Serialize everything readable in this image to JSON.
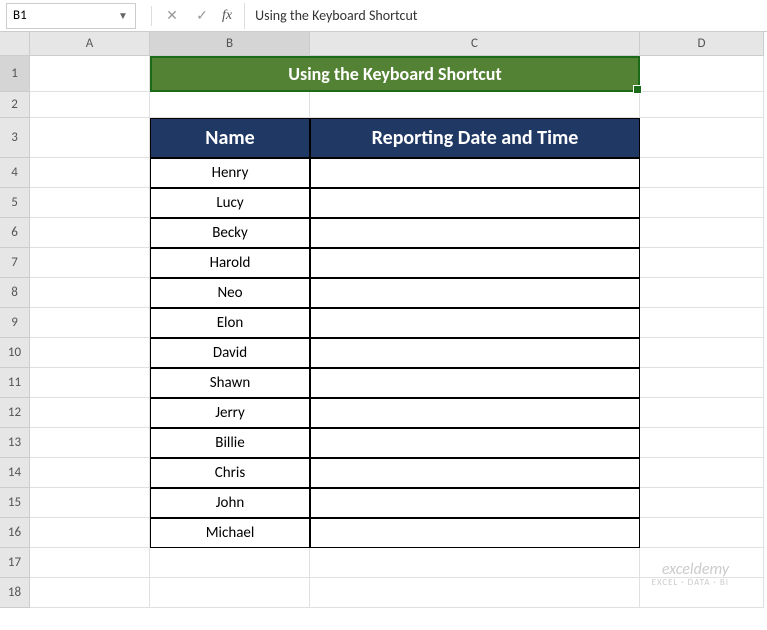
{
  "namebox": "B1",
  "formula_value": "Using the Keyboard Shortcut",
  "columns": [
    "A",
    "B",
    "C",
    "D"
  ],
  "rows": [
    "1",
    "2",
    "3",
    "4",
    "5",
    "6",
    "7",
    "8",
    "9",
    "10",
    "11",
    "12",
    "13",
    "14",
    "15",
    "16",
    "17",
    "18"
  ],
  "title": "Using the Keyboard Shortcut",
  "headers": {
    "name": "Name",
    "datetime": "Reporting Date and Time"
  },
  "names": [
    "Henry",
    "Lucy",
    "Becky",
    "Harold",
    "Neo",
    "Elon",
    "David",
    "Shawn",
    "Jerry",
    "Billie",
    "Chris",
    "John",
    "Michael"
  ],
  "watermark": {
    "main": "exceldemy",
    "sub": "EXCEL · DATA · BI"
  },
  "chart_data": {
    "type": "table",
    "columns": [
      "Name",
      "Reporting Date and Time"
    ],
    "rows": [
      [
        "Henry",
        ""
      ],
      [
        "Lucy",
        ""
      ],
      [
        "Becky",
        ""
      ],
      [
        "Harold",
        ""
      ],
      [
        "Neo",
        ""
      ],
      [
        "Elon",
        ""
      ],
      [
        "David",
        ""
      ],
      [
        "Shawn",
        ""
      ],
      [
        "Jerry",
        ""
      ],
      [
        "Billie",
        ""
      ],
      [
        "Chris",
        ""
      ],
      [
        "John",
        ""
      ],
      [
        "Michael",
        ""
      ]
    ]
  }
}
